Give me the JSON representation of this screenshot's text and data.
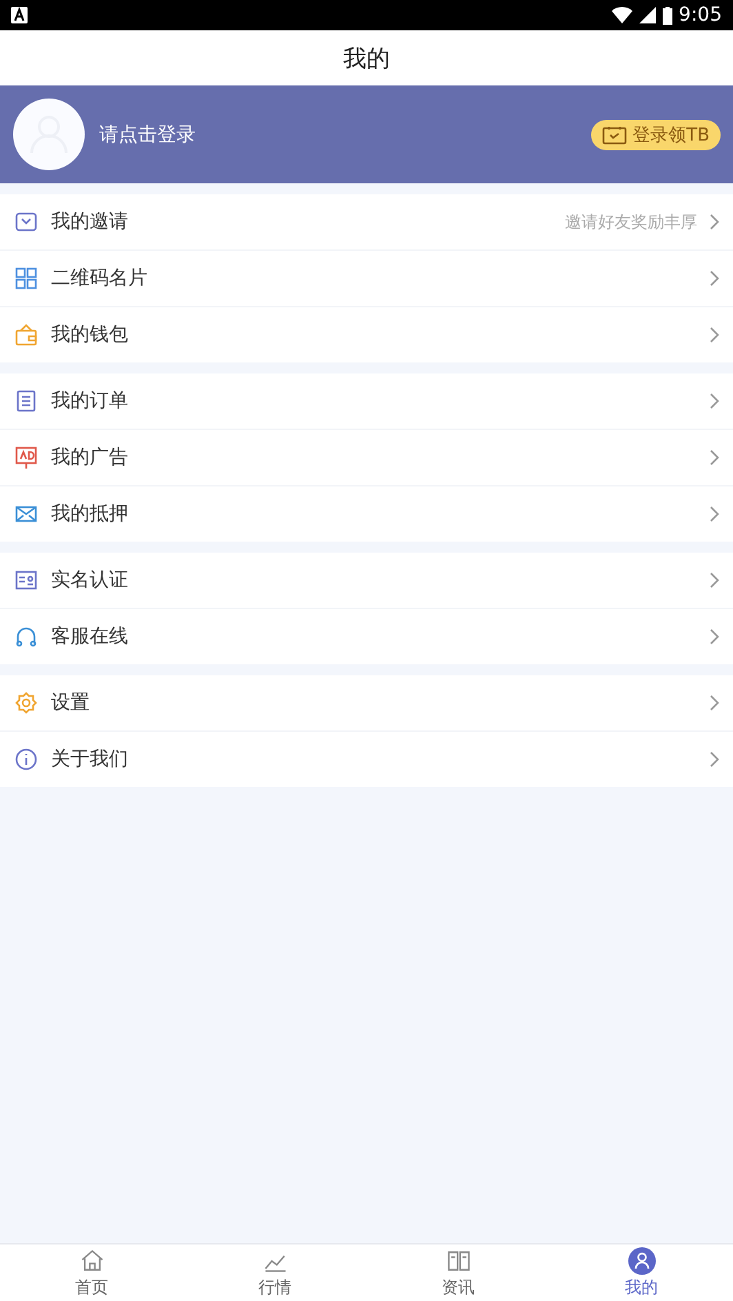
{
  "status_bar": {
    "time": "9:05"
  },
  "header": {
    "title": "我的"
  },
  "profile": {
    "login_prompt": "请点击登录",
    "reward_button": "登录领TB"
  },
  "menu_groups": [
    [
      {
        "label": "我的邀请",
        "hint": "邀请好友奖励丰厚"
      },
      {
        "label": "二维码名片"
      },
      {
        "label": "我的钱包"
      }
    ],
    [
      {
        "label": "我的订单"
      },
      {
        "label": "我的广告"
      },
      {
        "label": "我的抵押"
      }
    ],
    [
      {
        "label": "实名认证"
      },
      {
        "label": "客服在线"
      }
    ],
    [
      {
        "label": "设置"
      },
      {
        "label": "关于我们"
      }
    ]
  ],
  "tab_bar": [
    {
      "label": "首页",
      "selected": false
    },
    {
      "label": "行情",
      "selected": false
    },
    {
      "label": "资讯",
      "selected": false
    },
    {
      "label": "我的",
      "selected": true
    }
  ]
}
